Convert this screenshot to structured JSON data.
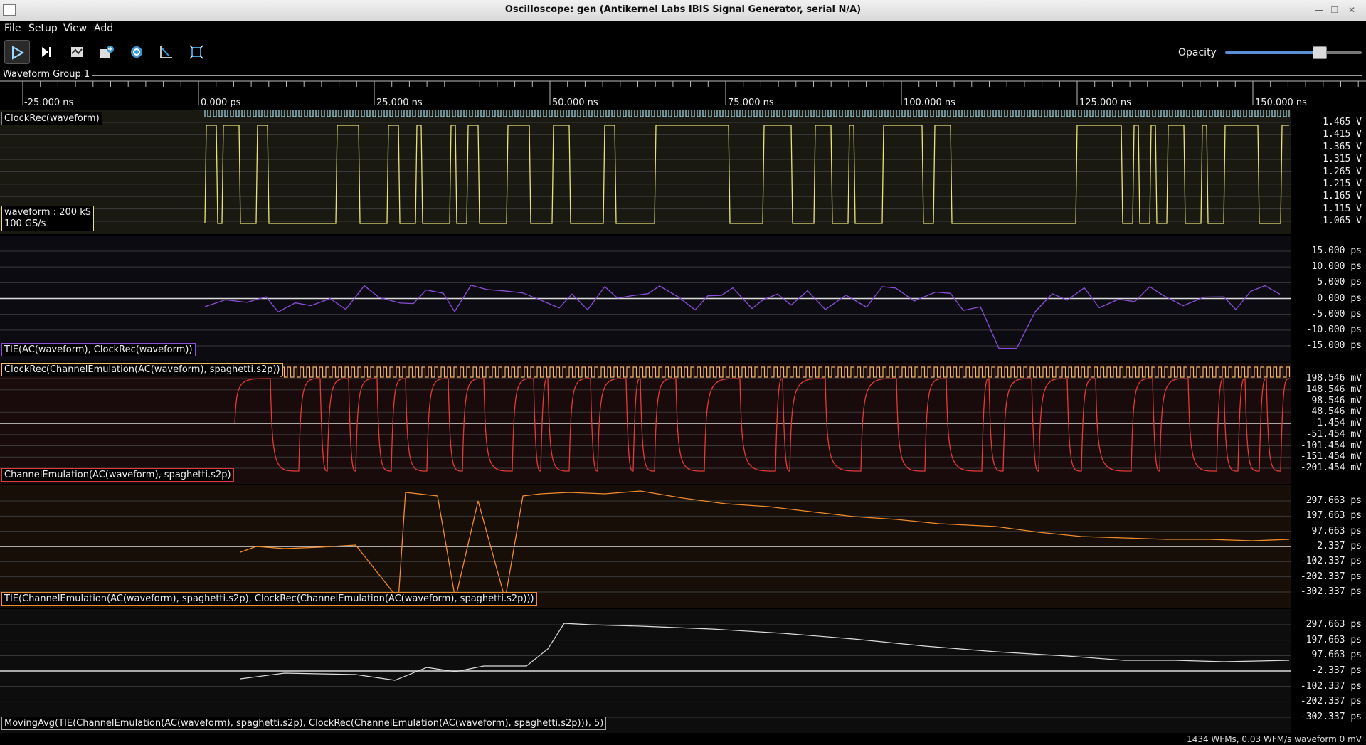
{
  "window": {
    "title": "Oscilloscope: gen (Antikernel Labs IBIS Signal Generator, serial N/A)"
  },
  "menu": [
    "File",
    "Setup",
    "View",
    "Add"
  ],
  "toolbar": {
    "buttons": [
      "start-icon",
      "single-trigger-icon",
      "history-icon",
      "add-measurement-icon",
      "settings-icon",
      "trend-icon",
      "fullscreen-icon"
    ],
    "opacity_label": "Opacity",
    "opacity": 0.86
  },
  "group": {
    "label": "Waveform Group 1"
  },
  "timeline": {
    "ticks": [
      "-25.000 ns",
      "0.000 ps",
      "25.000 ns",
      "50.000 ns",
      "75.000 ns",
      "100.000 ns",
      "125.000 ns",
      "150.000 ns"
    ]
  },
  "panels": [
    {
      "axis_labels": [
        "1.465 V",
        "1.415 V",
        "1.365 V",
        "1.315 V",
        "1.265 V",
        "1.215 V",
        "1.165 V",
        "1.115 V",
        "1.065 V"
      ],
      "labels": [
        "ClockRec(waveform)",
        "waveform : 200 kS",
        "100 GS/s"
      ],
      "colors": {
        "trace": "#e8e27a",
        "clock": "#a8d8ea",
        "bg": "#2a2a1c"
      }
    },
    {
      "axis_labels": [
        "15.000 ps",
        "10.000 ps",
        "5.000 ps",
        "0.000 ps",
        "-5.000 ps",
        "-10.000 ps",
        "-15.000 ps"
      ],
      "labels": [
        "TIE(AC(waveform), ClockRec(waveform))"
      ],
      "colors": {
        "trace": "#8a4fd8",
        "bg": "#15121e"
      }
    },
    {
      "axis_labels": [
        "198.546 mV",
        "148.546 mV",
        "98.546 mV",
        "48.546 mV",
        "-1.454 mV",
        "-51.454 mV",
        "-101.454 mV",
        "-151.454 mV",
        "-201.454 mV"
      ],
      "labels": [
        "ClockRec(ChannelEmulation(AC(waveform), spaghetti.s2p))",
        "ChannelEmulation(AC(waveform), spaghetti.s2p)"
      ],
      "colors": {
        "trace": "#e23a3a",
        "clock": "#f0b868",
        "bg": "#2a1212"
      }
    },
    {
      "axis_labels": [
        "297.663 ps",
        "197.663 ps",
        "97.663 ps",
        "-2.337 ps",
        "-102.337 ps",
        "-202.337 ps",
        "-302.337 ps"
      ],
      "labels": [
        "TIE(ChannelEmulation(AC(waveform), spaghetti.s2p), ClockRec(ChannelEmulation(AC(waveform), spaghetti.s2p)))"
      ],
      "colors": {
        "trace": "#f08c2e",
        "bg": "#24180c"
      }
    },
    {
      "axis_labels": [
        "297.663 ps",
        "197.663 ps",
        "97.663 ps",
        "-2.337 ps",
        "-102.337 ps",
        "-202.337 ps",
        "-302.337 ps"
      ],
      "labels": [
        "MovingAvg(TIE(ChannelEmulation(AC(waveform), spaghetti.s2p), ClockRec(ChannelEmulation(AC(waveform), spaghetti.s2p))), 5)"
      ],
      "colors": {
        "trace": "#dddddd",
        "bg": "#151515"
      }
    }
  ],
  "status": {
    "text": "1434 WFMs, 0.03 WFM/s   waveform 0 mV"
  }
}
